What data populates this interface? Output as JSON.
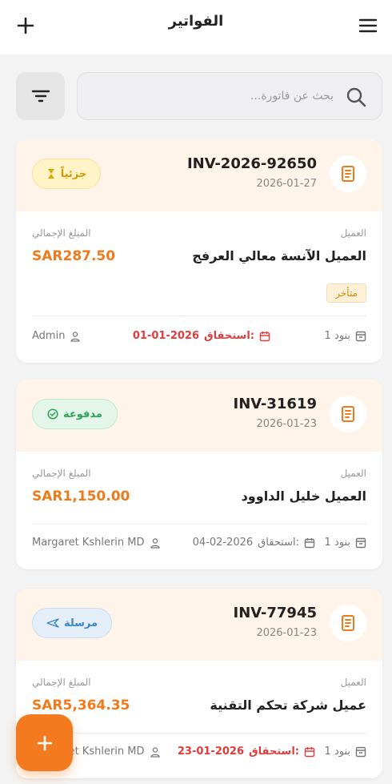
{
  "header": {
    "title": "الفواتير"
  },
  "search": {
    "placeholder": "بحث عن فاتورة..."
  },
  "labels": {
    "client": "العميل",
    "total": "المبلغ الإجمالي",
    "due_prefix": "استحقاق:"
  },
  "invoices": [
    {
      "number": "INV-2026-92650",
      "date": "2026-01-27",
      "status": "جزئياً",
      "client": "العميل الآنسة معالي العرفج",
      "amount": "SAR287.50",
      "late_tag": "متأخر",
      "items": "1 بنود",
      "due_date": "01-01-2026",
      "user": "Admin"
    },
    {
      "number": "INV-31619",
      "date": "2026-01-23",
      "status": "مدفوعة",
      "client": "العميل خليل الداوود",
      "amount": "SAR1,150.00",
      "items": "1 بنود",
      "due_date": "04-02-2026",
      "user": "Margaret Kshlerin MD"
    },
    {
      "number": "INV-77945",
      "date": "2026-01-23",
      "status": "مرسلة",
      "client": "عميل شركة تحكم التقنية",
      "amount": "SAR5,364.35",
      "items": "1 بنود",
      "due_date": "23-01-2026",
      "user": "Margaret Kshlerin MD"
    }
  ],
  "colors": {
    "accent": "#f47a1f",
    "card_header_bg": "#fff4ea",
    "overdue": "#e23b3b",
    "paid": "#2fa35a",
    "partial": "#d29a00",
    "sent": "#3a86c8"
  },
  "icons": {
    "header_left": "plus-icon",
    "header_right": "hamburger-menu-icon",
    "filter": "filter-icon",
    "search": "search-icon",
    "invoice": "receipt-icon",
    "items": "archive-box-icon",
    "due": "calendar-icon",
    "user": "user-icon",
    "fab": "plus-icon"
  }
}
